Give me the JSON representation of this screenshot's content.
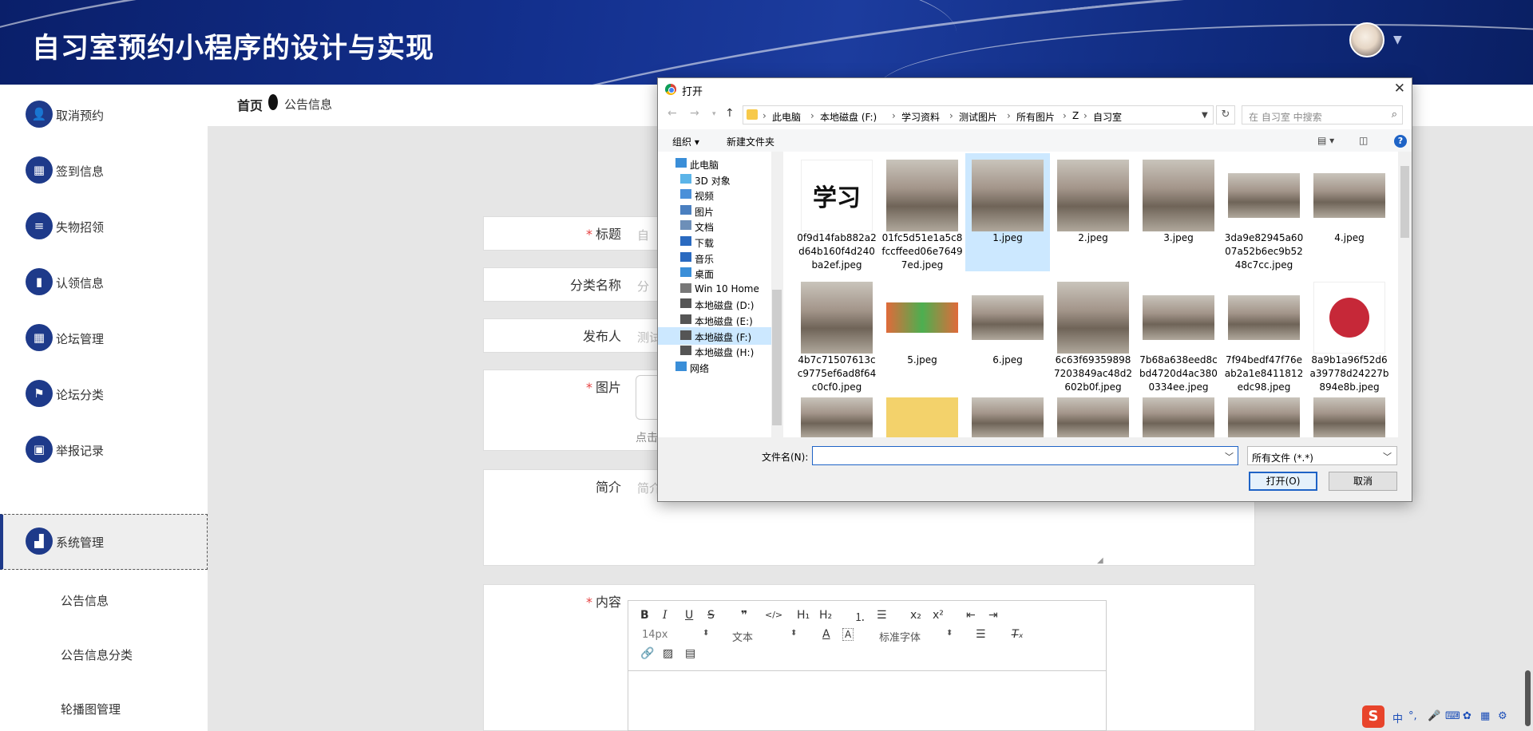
{
  "header": {
    "title": "自习室预约小程序的设计与实现"
  },
  "sidebar": {
    "items": [
      {
        "label": "取消预约",
        "icon": "user-icon"
      },
      {
        "label": "签到信息",
        "icon": "grid-icon"
      },
      {
        "label": "失物招领",
        "icon": "list-icon"
      },
      {
        "label": "认领信息",
        "icon": "book-icon"
      },
      {
        "label": "论坛管理",
        "icon": "grid-icon"
      },
      {
        "label": "论坛分类",
        "icon": "flag-icon"
      },
      {
        "label": "举报记录",
        "icon": "clipboard-icon"
      },
      {
        "label": "系统管理",
        "icon": "bar-chart-icon"
      }
    ],
    "subitems": [
      "公告信息",
      "公告信息分类",
      "轮播图管理"
    ]
  },
  "breadcrumb": {
    "home": "首页",
    "current": "公告信息"
  },
  "form": {
    "required_mark": "*",
    "title_label": "标题",
    "title_placeholder": "自",
    "category_label": "分类名称",
    "category_placeholder": "分",
    "publisher_label": "发布人",
    "publisher_value": "测试",
    "image_label": "图片",
    "image_hint": "点击",
    "summary_label": "简介",
    "summary_placeholder": "简介",
    "content_label": "内容"
  },
  "editor": {
    "font_size": "14px",
    "paragraph": "文本",
    "font_family": "标准字体",
    "h1": "H₁",
    "h2": "H₂"
  },
  "dialog": {
    "title": "打开",
    "path": [
      "此电脑",
      "本地磁盘 (F:)",
      "学习资料",
      "测试图片",
      "所有图片",
      "Z",
      "自习室"
    ],
    "search_placeholder": "在 自习室 中搜索",
    "organize": "组织 ▾",
    "new_folder": "新建文件夹",
    "tree": [
      "此电脑",
      "3D 对象",
      "视频",
      "图片",
      "文档",
      "下载",
      "音乐",
      "桌面",
      "Win 10 Home",
      "本地磁盘 (D:)",
      "本地磁盘 (E:)",
      "本地磁盘 (F:)",
      "本地磁盘 (H:)",
      "网络"
    ],
    "files": [
      "0f9d14fab882a2d64b160f4d240ba2ef.jpeg",
      "01fc5d51e1a5c8fccffeed06e76497ed.jpeg",
      "1.jpeg",
      "2.jpeg",
      "3.jpeg",
      "3da9e82945a6007a52b6ec9b5248c7cc.jpeg",
      "4.jpeg",
      "4b7c71507613cc9775ef6ad8f64c0cf0.jpeg",
      "5.jpeg",
      "6.jpeg",
      "6c63f693598987203849ac48d2602b0f.jpeg",
      "7b68a638eed8cbd4720d4ac3800334ee.jpeg",
      "7f94bedf47f76eab2a1e8411812edc98.jpeg",
      "8a9b1a96f52d6a39778d24227b894e8b.jpeg"
    ],
    "filename_label": "文件名(N):",
    "filetype": "所有文件 (*.*)",
    "open": "打开(O)",
    "cancel": "取消"
  },
  "ime": {
    "label": "中"
  }
}
